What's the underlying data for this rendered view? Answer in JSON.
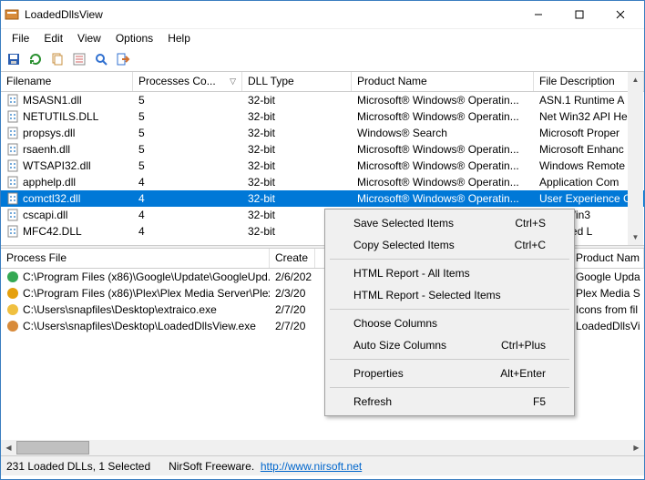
{
  "window": {
    "title": "LoadedDllsView"
  },
  "menu": {
    "file": "File",
    "edit": "Edit",
    "view": "View",
    "options": "Options",
    "help": "Help"
  },
  "top_columns": {
    "filename": "Filename",
    "processes": "Processes Co...",
    "dlltype": "DLL Type",
    "product": "Product Name",
    "desc": "File Description"
  },
  "rows": [
    {
      "file": "MSASN1.dll",
      "pc": "5",
      "type": "32-bit",
      "prod": "Microsoft® Windows® Operatin...",
      "desc": "ASN.1 Runtime A"
    },
    {
      "file": "NETUTILS.DLL",
      "pc": "5",
      "type": "32-bit",
      "prod": "Microsoft® Windows® Operatin...",
      "desc": "Net Win32 API He"
    },
    {
      "file": "propsys.dll",
      "pc": "5",
      "type": "32-bit",
      "prod": "Windows® Search",
      "desc": "Microsoft Proper"
    },
    {
      "file": "rsaenh.dll",
      "pc": "5",
      "type": "32-bit",
      "prod": "Microsoft® Windows® Operatin...",
      "desc": "Microsoft Enhanc"
    },
    {
      "file": "WTSAPI32.dll",
      "pc": "5",
      "type": "32-bit",
      "prod": "Microsoft® Windows® Operatin...",
      "desc": "Windows Remote"
    },
    {
      "file": "apphelp.dll",
      "pc": "4",
      "type": "32-bit",
      "prod": "Microsoft® Windows® Operatin...",
      "desc": "Application Com"
    },
    {
      "file": "comctl32.dll",
      "pc": "4",
      "type": "32-bit",
      "prod": "Microsoft® Windows® Operatin...",
      "desc": "User Experience C",
      "selected": true
    },
    {
      "file": "cscapi.dll",
      "pc": "4",
      "type": "32-bit",
      "prod": "",
      "desc": "Files Win3"
    },
    {
      "file": "MFC42.DLL",
      "pc": "4",
      "type": "32-bit",
      "prod": "",
      "desc": "L Shared L"
    }
  ],
  "bottom_columns": {
    "process": "Process File",
    "created": "Create",
    "product": "Product Nam"
  },
  "bottom_rows": [
    {
      "file": "C:\\Program Files (x86)\\Google\\Update\\GoogleUpd...",
      "date": "2/6/202",
      "prod": "Google Upda",
      "icon": "g"
    },
    {
      "file": "C:\\Program Files (x86)\\Plex\\Plex Media Server\\Plex...",
      "date": "2/3/20",
      "prod": "Plex Media S",
      "icon": "p"
    },
    {
      "file": "C:\\Users\\snapfiles\\Desktop\\extraico.exe",
      "date": "2/7/20",
      "prod": "Icons from fil",
      "icon": "e"
    },
    {
      "file": "C:\\Users\\snapfiles\\Desktop\\LoadedDllsView.exe",
      "date": "2/7/20",
      "prod": "LoadedDllsVi",
      "icon": "l"
    }
  ],
  "context": {
    "save": "Save Selected Items",
    "save_key": "Ctrl+S",
    "copy": "Copy Selected Items",
    "copy_key": "Ctrl+C",
    "html_all": "HTML Report - All Items",
    "html_sel": "HTML Report - Selected Items",
    "choose": "Choose Columns",
    "auto": "Auto Size Columns",
    "auto_key": "Ctrl+Plus",
    "props": "Properties",
    "props_key": "Alt+Enter",
    "refresh": "Refresh",
    "refresh_key": "F5"
  },
  "status": {
    "count": "231 Loaded DLLs, 1 Selected",
    "brand": "NirSoft Freeware.",
    "url": "http://www.nirsoft.net"
  }
}
